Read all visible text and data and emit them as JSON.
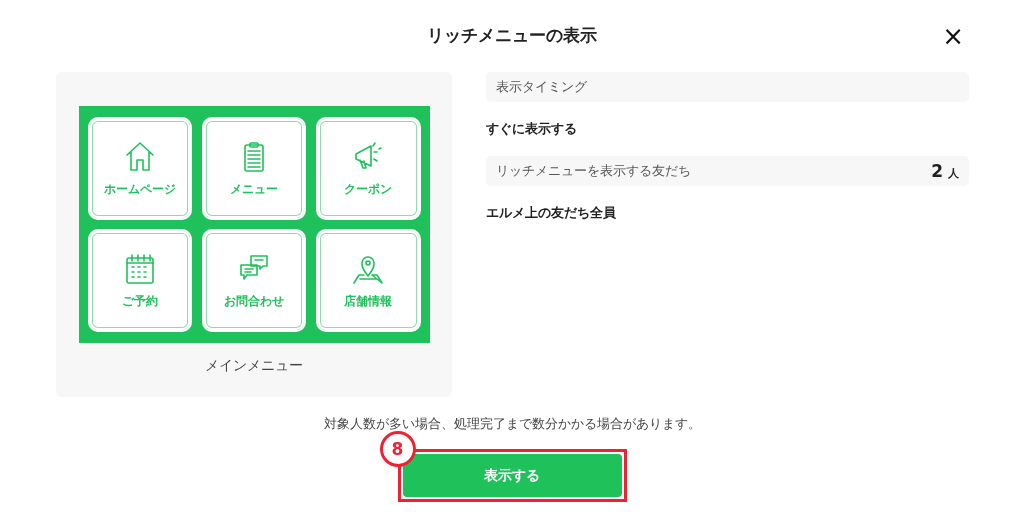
{
  "dialog": {
    "title": "リッチメニューの表示",
    "close": "×"
  },
  "preview": {
    "tiles": [
      {
        "label": "ホームページ"
      },
      {
        "label": "メニュー"
      },
      {
        "label": "クーポン"
      },
      {
        "label": "ご予約"
      },
      {
        "label": "お問合わせ"
      },
      {
        "label": "店舗情報"
      }
    ],
    "caption": "メインメニュー"
  },
  "settings": {
    "timing_label": "表示タイミング",
    "timing_value": "すぐに表示する",
    "friends_label": "リッチメニューを表示する友だち",
    "friends_count": "2",
    "friends_unit": "人",
    "friends_value": "エルメ上の友だち全員"
  },
  "notice": "対象人数が多い場合、処理完了まで数分かかる場合があります。",
  "submit": {
    "label": "表示する",
    "annotation": "8"
  }
}
